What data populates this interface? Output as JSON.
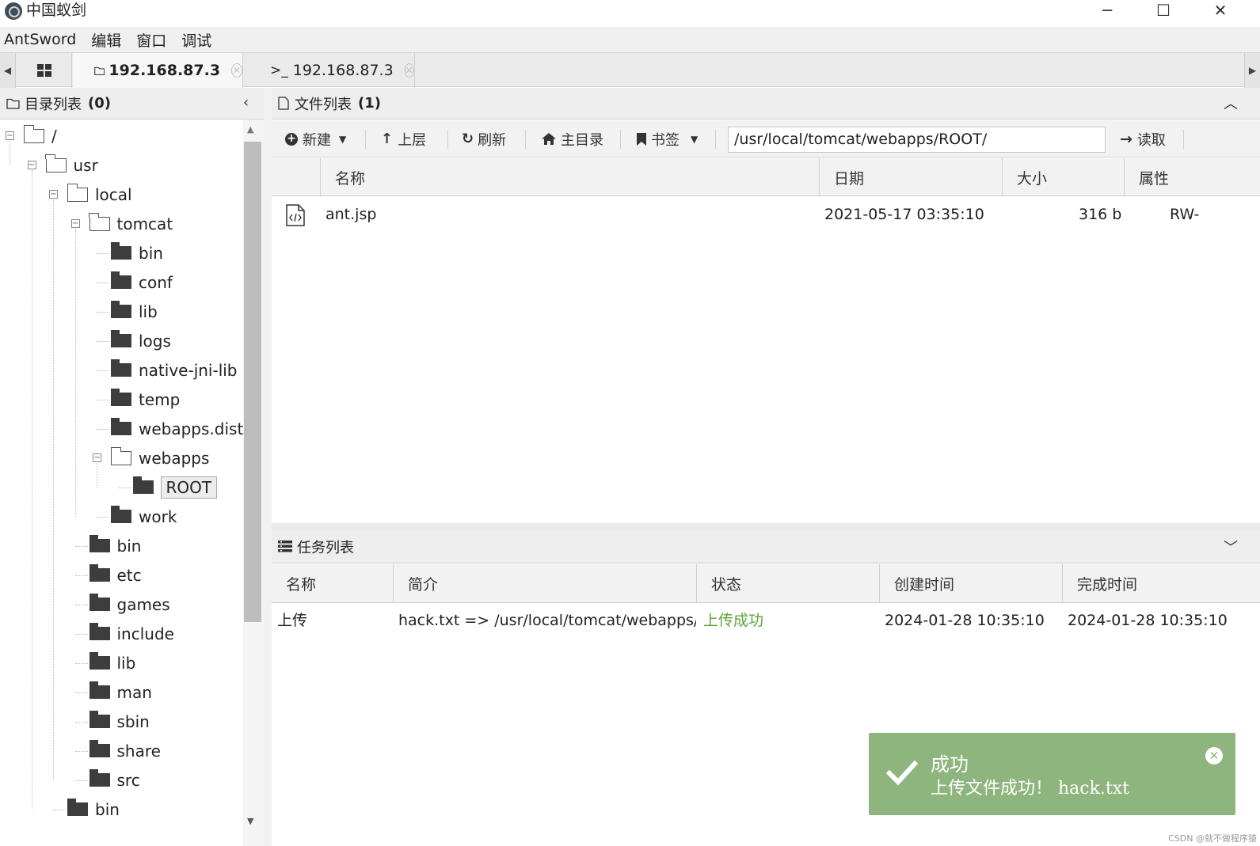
{
  "window": {
    "title": "中国蚁剑",
    "controls": {
      "minimize": "─",
      "maximize": "☐",
      "close": "✕"
    }
  },
  "menu": [
    "AntSword",
    "编辑",
    "窗口",
    "调试"
  ],
  "tabs": [
    {
      "label": "192.168.87.3",
      "icon": "folder-icon",
      "active": true
    },
    {
      "label": "192.168.87.3",
      "icon": "terminal-icon",
      "prefix": ">_",
      "active": false
    }
  ],
  "dir_panel": {
    "title": "目录列表",
    "count": "(0)",
    "tree": [
      {
        "label": "/",
        "depth": 0,
        "open": true
      },
      {
        "label": "usr",
        "depth": 1,
        "open": true
      },
      {
        "label": "local",
        "depth": 2,
        "open": true
      },
      {
        "label": "tomcat",
        "depth": 3,
        "open": true
      },
      {
        "label": "bin",
        "depth": 4
      },
      {
        "label": "conf",
        "depth": 4
      },
      {
        "label": "lib",
        "depth": 4
      },
      {
        "label": "logs",
        "depth": 4
      },
      {
        "label": "native-jni-lib",
        "depth": 4
      },
      {
        "label": "temp",
        "depth": 4
      },
      {
        "label": "webapps.dist",
        "depth": 4
      },
      {
        "label": "webapps",
        "depth": 4,
        "open": true
      },
      {
        "label": "ROOT",
        "depth": 5,
        "selected": true
      },
      {
        "label": "work",
        "depth": 4
      },
      {
        "label": "bin",
        "depth": 3
      },
      {
        "label": "etc",
        "depth": 3
      },
      {
        "label": "games",
        "depth": 3
      },
      {
        "label": "include",
        "depth": 3
      },
      {
        "label": "lib",
        "depth": 3
      },
      {
        "label": "man",
        "depth": 3
      },
      {
        "label": "sbin",
        "depth": 3
      },
      {
        "label": "share",
        "depth": 3
      },
      {
        "label": "src",
        "depth": 3
      },
      {
        "label": "bin",
        "depth": 2
      }
    ]
  },
  "file_panel": {
    "title": "文件列表",
    "count": "(1)",
    "toolbar": {
      "new": "新建",
      "up": "上层",
      "refresh": "刷新",
      "home": "主目录",
      "bookmark": "书签",
      "path": "/usr/local/tomcat/webapps/ROOT/",
      "read": "读取"
    },
    "columns": [
      "名称",
      "日期",
      "大小",
      "属性"
    ],
    "rows": [
      {
        "name": "ant.jsp",
        "date": "2021-05-17 03:35:10",
        "size": "316 b",
        "attr": "RW-"
      }
    ]
  },
  "task_panel": {
    "title": "任务列表",
    "columns": [
      "名称",
      "简介",
      "状态",
      "创建时间",
      "完成时间"
    ],
    "rows": [
      {
        "name": "上传",
        "desc": "hack.txt => /usr/local/tomcat/webapps/RC",
        "status": "上传成功",
        "created": "2024-01-28 10:35:10",
        "finished": "2024-01-28 10:35:10"
      }
    ]
  },
  "toast": {
    "title": "成功",
    "message": "上传文件成功！ hack.txt"
  },
  "watermark": "CSDN @就不做程序猿",
  "colors": {
    "success_green": "#5fa33a",
    "toast_bg": "#8fb57f"
  }
}
